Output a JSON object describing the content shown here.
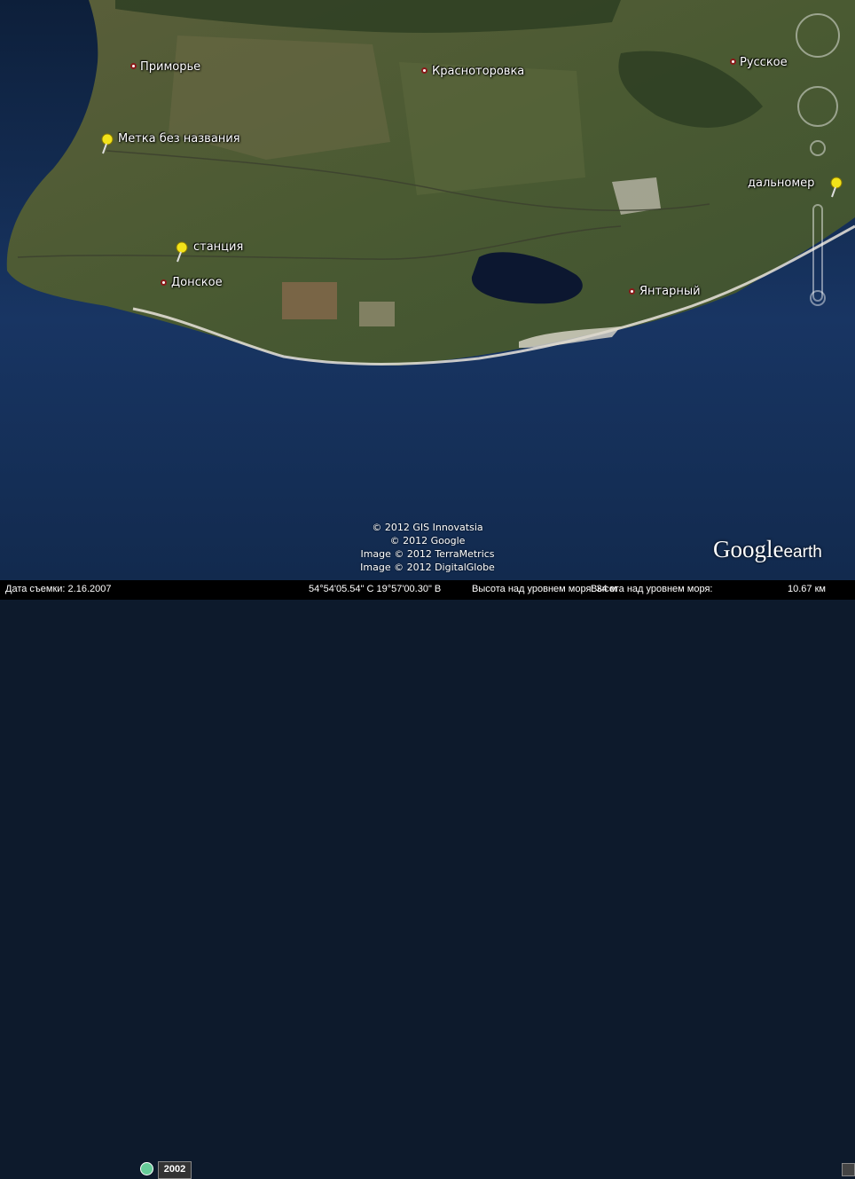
{
  "map": {
    "places": [
      {
        "name": "Приморье",
        "marker": "dot"
      },
      {
        "name": "Красноторовка",
        "marker": "dot"
      },
      {
        "name": "Русское",
        "marker": "dot"
      },
      {
        "name": "Метка без названия",
        "marker": "pin"
      },
      {
        "name": "дальномер",
        "marker": "pin"
      },
      {
        "name": "станция",
        "marker": "pin"
      },
      {
        "name": "Донское",
        "marker": "dot"
      },
      {
        "name": "Янтарный",
        "marker": "dot"
      }
    ],
    "colors": {
      "sea": "#12284a",
      "land": "#4d5a34",
      "lake": "#0c1730",
      "beach": "#e9e4dc",
      "pin": "#f2e31a"
    }
  },
  "credits": [
    "© 2012 GIS Innovatsia",
    "© 2012 Google",
    "Image © 2012 TerraMetrics",
    "Image © 2012 DigitalGlobe"
  ],
  "logo": {
    "brand": "Google",
    "product": "earth"
  },
  "status": {
    "capture_date": "Дата съемки: 2.16.2007",
    "year": "2002",
    "coords": "54°54'05.54\" С  19°57'00.30\" В",
    "elevation": "Высота над уровнем моря: 34 м",
    "eye_alt_label": "Высота над уровнем моря:",
    "eye_alt_value": "10.67 км"
  }
}
